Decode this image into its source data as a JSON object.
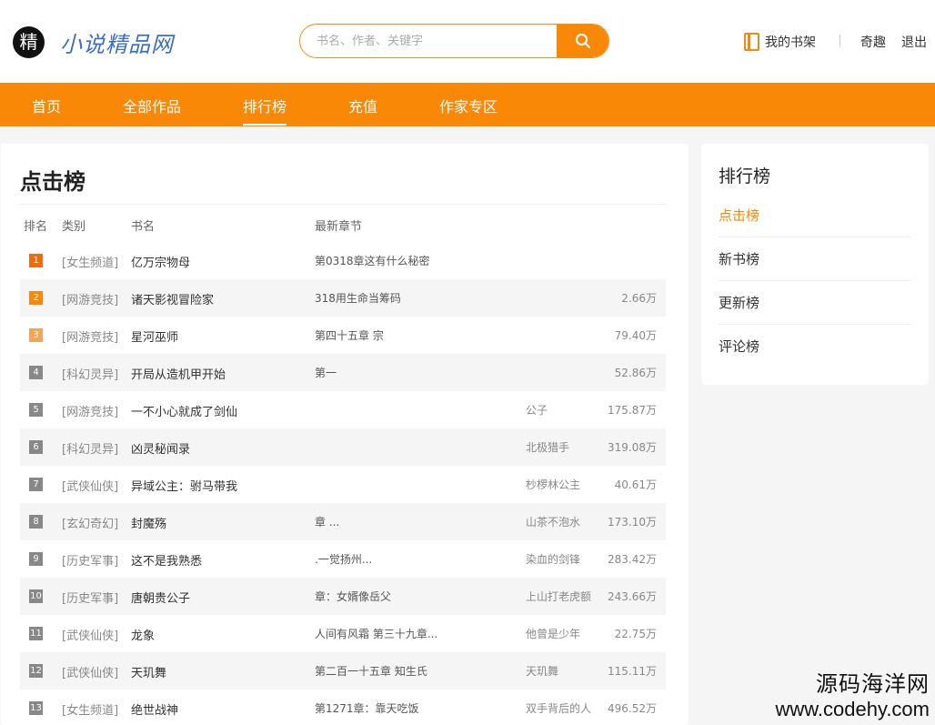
{
  "brand": {
    "logo_char": "精",
    "name": "小说精品网"
  },
  "search": {
    "placeholder": "书名、作者、关键字"
  },
  "header": {
    "bookshelf": "我的书架",
    "username": "奇趣",
    "logout": "退出"
  },
  "nav": {
    "items": [
      "首页",
      "全部作品",
      "排行榜",
      "充值",
      "作家专区"
    ],
    "active": "排行榜"
  },
  "ranking": {
    "title": "点击榜",
    "columns": {
      "rank": "排名",
      "category": "类别",
      "name": "书名",
      "chapter": "最新章节"
    },
    "rows": [
      {
        "rank": "1",
        "category": "[女生频道]",
        "name": "亿万宗物母",
        "chapter": "第0318章这有什么秘密",
        "author": "",
        "count": ""
      },
      {
        "rank": "2",
        "category": "[网游竞技]",
        "name": "诸天影视冒险家",
        "chapter": "318用生命当筹码",
        "author": "",
        "count": "2.66万"
      },
      {
        "rank": "3",
        "category": "[网游竞技]",
        "name": "星河巫师",
        "chapter": "第四十五章 宗",
        "author": "",
        "count": "79.40万"
      },
      {
        "rank": "4",
        "category": "[科幻灵异]",
        "name": "开局从造机甲开始",
        "chapter": "第一",
        "author": "",
        "count": "52.86万"
      },
      {
        "rank": "5",
        "category": "[网游竞技]",
        "name": "一不小心就成了剑仙",
        "chapter": "",
        "author": "公子",
        "count": "175.87万"
      },
      {
        "rank": "6",
        "category": "[科幻灵异]",
        "name": "凶灵秘闻录",
        "chapter": "",
        "author": "北极猎手",
        "count": "319.08万"
      },
      {
        "rank": "7",
        "category": "[武侠仙侠]",
        "name": "异域公主：驸马带我",
        "chapter": "",
        "author": "杪椤林公主",
        "count": "40.61万"
      },
      {
        "rank": "8",
        "category": "[玄幻奇幻]",
        "name": "封魔殇",
        "chapter": "章 ...",
        "author": "山茶不泡水",
        "count": "173.10万"
      },
      {
        "rank": "9",
        "category": "[历史军事]",
        "name": "这不是我熟悉",
        "chapter": ".一觉扬州...",
        "author": "染血的剑锋",
        "count": "283.42万"
      },
      {
        "rank": "10",
        "category": "[历史军事]",
        "name": "唐朝贵公子",
        "chapter": "章：女婿像岳父",
        "author": "上山打老虎额",
        "count": "243.66万"
      },
      {
        "rank": "11",
        "category": "[武侠仙侠]",
        "name": "龙象",
        "chapter": "人间有风霜 第三十九章...",
        "author": "他曾是少年",
        "count": "22.75万"
      },
      {
        "rank": "12",
        "category": "[武侠仙侠]",
        "name": "天玑舞",
        "chapter": "第二百一十五章 知生氏",
        "author": "天玑舞",
        "count": "115.11万"
      },
      {
        "rank": "13",
        "category": "[女生频道]",
        "name": "绝世战神",
        "chapter": "第1271章：靠天吃饭",
        "author": "双手背后的人",
        "count": "496.52万"
      }
    ]
  },
  "sidebar": {
    "title": "排行榜",
    "items": [
      "点击榜",
      "新书榜",
      "更新榜",
      "评论榜"
    ],
    "active": "点击榜"
  },
  "watermark": {
    "line1": "源码海洋网",
    "line2": "www.codehy.com"
  },
  "colors": {
    "accent": "#f98807",
    "rank1": "#f26a0e",
    "rank2": "#f98807",
    "rank3": "#f5a455",
    "rank_other": "#888888",
    "brand_text": "#3a6fc4"
  }
}
